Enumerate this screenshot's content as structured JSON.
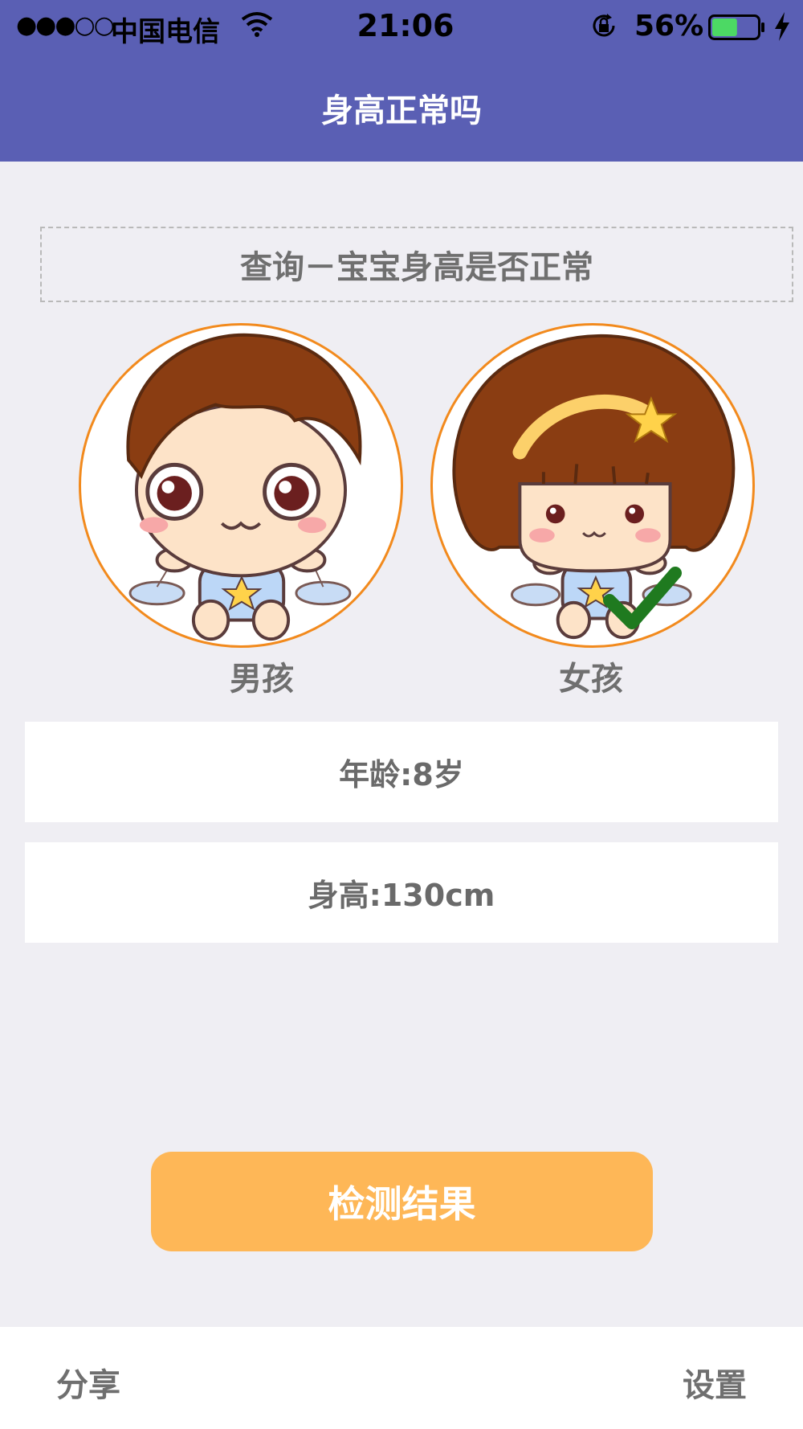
{
  "status_bar": {
    "signal": "●●●○○",
    "carrier": "中国电信",
    "time": "21:06",
    "battery_percent": "56%",
    "battery_level": 0.56,
    "icons": [
      "wifi-icon",
      "orientation-lock-icon",
      "battery-icon",
      "charging-bolt-icon"
    ]
  },
  "nav": {
    "title": "身高正常吗"
  },
  "query_banner": {
    "text": "查询－宝宝身高是否正常"
  },
  "gender": {
    "options": [
      {
        "label": "男孩",
        "selected": false
      },
      {
        "label": "女孩",
        "selected": true
      }
    ],
    "selected_icon": "checkmark-icon"
  },
  "form": {
    "age": "年龄:8岁",
    "height": "身高:130cm"
  },
  "result_button": {
    "label": "检测结果"
  },
  "bottom_bar": {
    "share": "分享",
    "settings": "设置"
  },
  "colors": {
    "nav_bg": "#5a5fb4",
    "page_bg": "#efeef3",
    "avatar_border": "#f28a1d",
    "button_bg": "#feb757",
    "check": "#1f7a1f"
  }
}
